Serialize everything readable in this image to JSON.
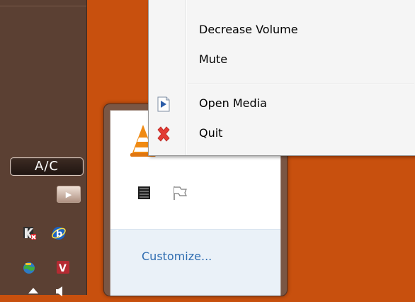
{
  "context_menu": {
    "items": [
      {
        "label": "Decrease Volume",
        "icon": null
      },
      {
        "label": "Mute",
        "icon": null
      },
      {
        "label": "Open Media",
        "icon": "open-media-icon"
      },
      {
        "label": "Quit",
        "icon": "quit-icon"
      }
    ]
  },
  "flyout": {
    "customize_label": "Customize..."
  },
  "taskbar": {
    "ac_label": "A/C"
  },
  "colors": {
    "desktop": "#c8500e",
    "taskbar": "#5b4033",
    "menu_bg": "#f5f5f5",
    "link": "#2f6db1"
  }
}
